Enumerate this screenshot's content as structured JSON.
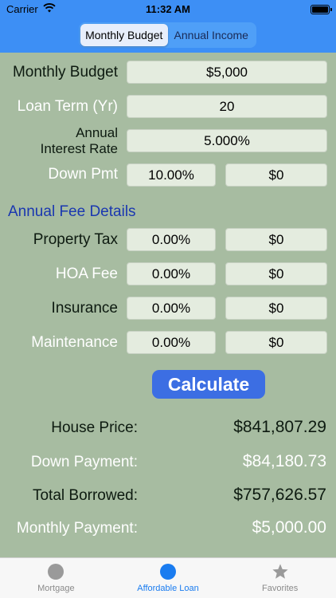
{
  "status": {
    "carrier": "Carrier",
    "time": "11:32 AM"
  },
  "segments": [
    {
      "label": "Monthly Budget",
      "active": true
    },
    {
      "label": "Annual Income",
      "active": false
    }
  ],
  "inputs": {
    "monthly_budget": {
      "label": "Monthly Budget",
      "value": "$5,000"
    },
    "loan_term": {
      "label": "Loan Term (Yr)",
      "value": "20"
    },
    "interest_rate": {
      "label_line1": "Annual",
      "label_line2": "Interest Rate",
      "value": "5.000%"
    },
    "down_pmt": {
      "label": "Down Pmt",
      "percent": "10.00%",
      "amount": "$0"
    }
  },
  "fees": {
    "title": "Annual Fee Details",
    "property_tax": {
      "label": "Property Tax",
      "percent": "0.00%",
      "amount": "$0"
    },
    "hoa_fee": {
      "label": "HOA Fee",
      "percent": "0.00%",
      "amount": "$0"
    },
    "insurance": {
      "label": "Insurance",
      "percent": "0.00%",
      "amount": "$0"
    },
    "maintenance": {
      "label": "Maintenance",
      "percent": "0.00%",
      "amount": "$0"
    }
  },
  "calculate_label": "Calculate",
  "results": {
    "house_price": {
      "label": "House Price:",
      "value": "$841,807.29"
    },
    "down_payment": {
      "label": "Down Payment:",
      "value": "$84,180.73"
    },
    "total_borrowed": {
      "label": "Total Borrowed:",
      "value": "$757,626.57"
    },
    "monthly_payment": {
      "label": "Monthly Payment:",
      "value": "$5,000.00"
    }
  },
  "tabs": [
    {
      "label": "Mortgage",
      "icon": "circle-icon"
    },
    {
      "label": "Affordable Loan",
      "icon": "circle-icon"
    },
    {
      "label": "Favorites",
      "icon": "star-icon"
    }
  ]
}
